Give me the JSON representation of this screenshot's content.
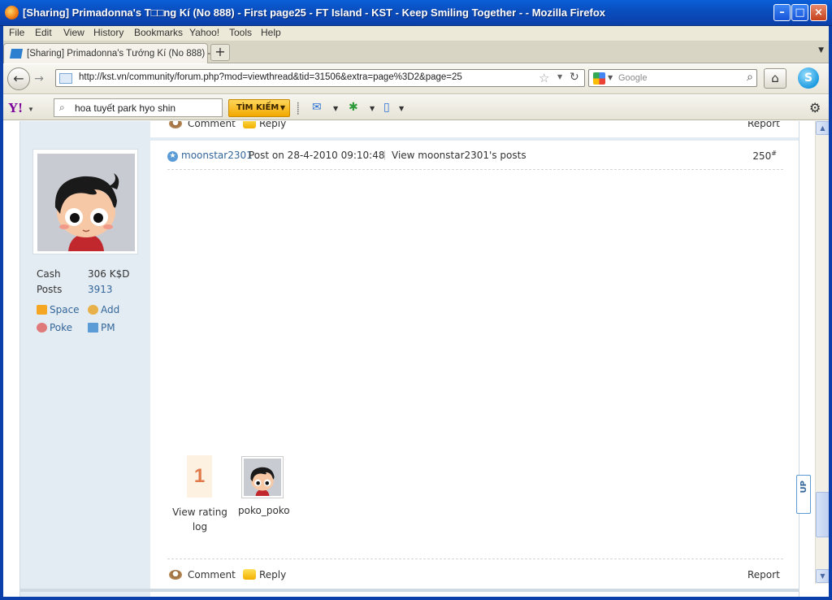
{
  "window": {
    "title": "[Sharing] Primadonna's T□□ng Kí (No 888) - First page25 - FT Island - KST - Keep Smiling Together - - Mozilla Firefox"
  },
  "menu": [
    "File",
    "Edit",
    "View",
    "History",
    "Bookmarks",
    "Yahoo!",
    "Tools",
    "Help"
  ],
  "tab": {
    "label": "[Sharing] Primadonna's Tướng Kí (No 888) - ..."
  },
  "nav": {
    "url": "http://kst.vn/community/forum.php?mod=viewthread&tid=31506&extra=page%3D2&page=25",
    "search_placeholder": "Google"
  },
  "yahoo": {
    "logo": "Y!",
    "search_value": "hoa tuyết park hyo shin",
    "search_button": "TÌM KIẾM"
  },
  "post": {
    "prev_comment": "Comment",
    "prev_reply": "Reply",
    "prev_report": "Report",
    "author": "moonstar2301",
    "posted_on": "Post on 28-4-2010 09:10:48",
    "view_posts": "View moonstar2301's posts",
    "floor": "250",
    "floor_mark": "#",
    "comment": "Comment",
    "reply": "Reply",
    "report": "Report"
  },
  "profile": {
    "cash_label": "Cash",
    "cash_value": "306 K$D",
    "posts_label": "Posts",
    "posts_value": "3913",
    "space": "Space",
    "add": "Add",
    "poke": "Poke",
    "pm": "PM"
  },
  "rating": {
    "count": "1",
    "log_label": "View rating log",
    "rater": "poko_poko"
  },
  "upbutton": "UP"
}
